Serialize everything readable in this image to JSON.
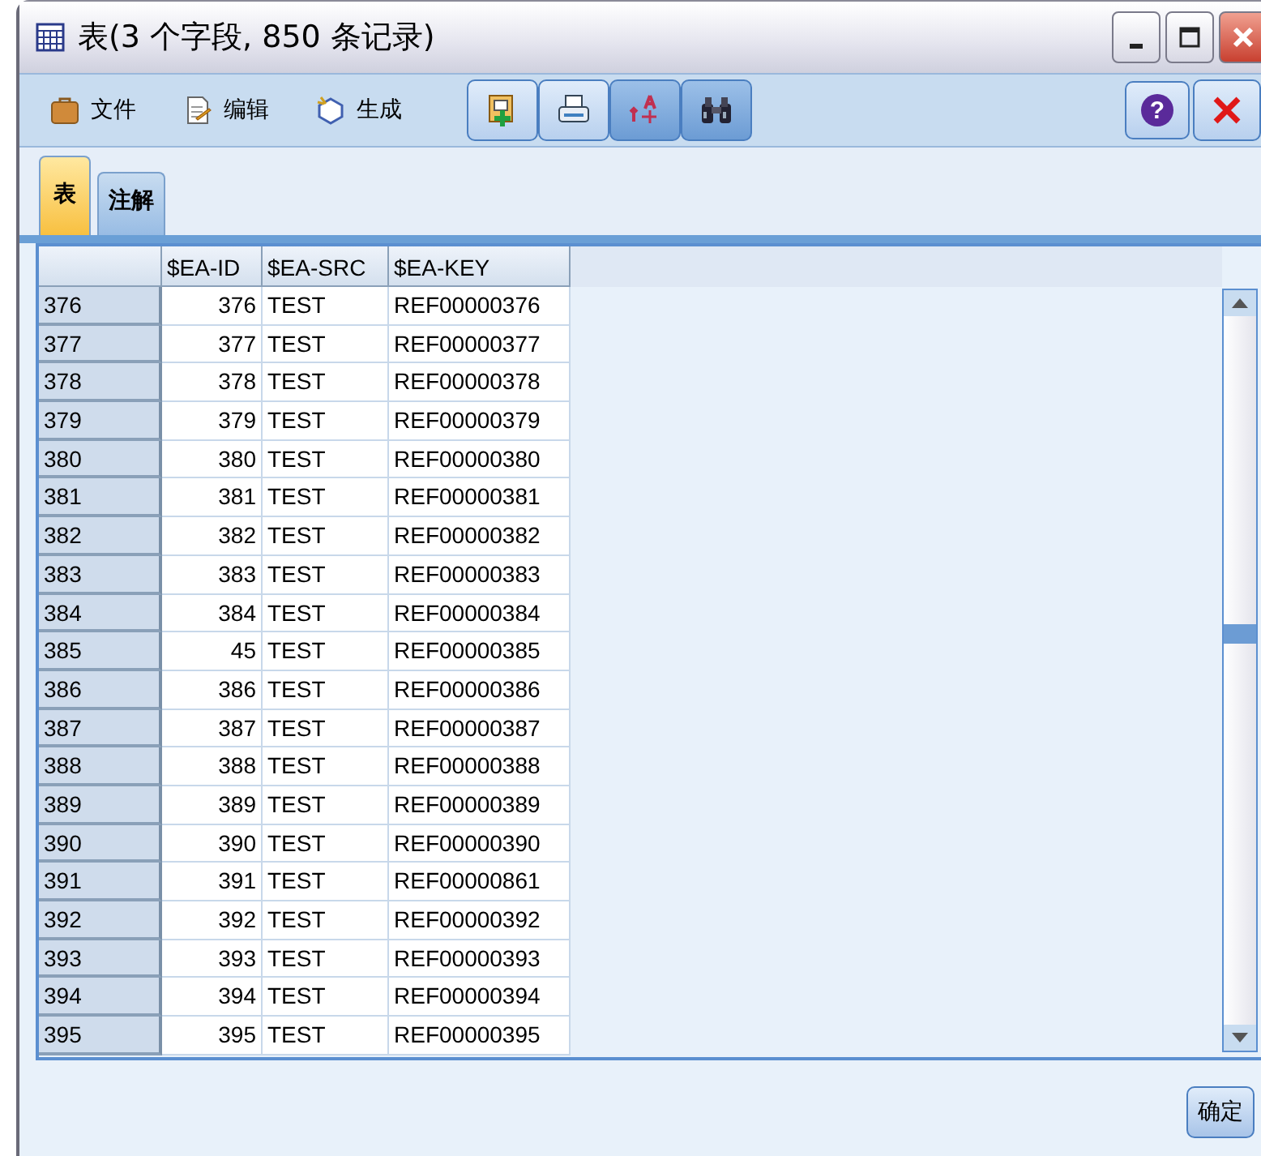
{
  "window": {
    "title": "表(3 个字段, 850 条记录)"
  },
  "toolbar": {
    "menus": [
      {
        "label": "文件",
        "kind": "file"
      },
      {
        "label": "编辑",
        "kind": "edit"
      },
      {
        "label": "生成",
        "kind": "generate"
      }
    ],
    "help": "?"
  },
  "tabs": [
    {
      "label": "表",
      "selected": true
    },
    {
      "label": "注解",
      "selected": false
    }
  ],
  "table": {
    "columns": [
      "$EA-ID",
      "$EA-SRC",
      "$EA-KEY"
    ],
    "rows": [
      {
        "row": "376",
        "id": "376",
        "src": "TEST",
        "key": "REF00000376"
      },
      {
        "row": "377",
        "id": "377",
        "src": "TEST",
        "key": "REF00000377"
      },
      {
        "row": "378",
        "id": "378",
        "src": "TEST",
        "key": "REF00000378"
      },
      {
        "row": "379",
        "id": "379",
        "src": "TEST",
        "key": "REF00000379"
      },
      {
        "row": "380",
        "id": "380",
        "src": "TEST",
        "key": "REF00000380"
      },
      {
        "row": "381",
        "id": "381",
        "src": "TEST",
        "key": "REF00000381"
      },
      {
        "row": "382",
        "id": "382",
        "src": "TEST",
        "key": "REF00000382"
      },
      {
        "row": "383",
        "id": "383",
        "src": "TEST",
        "key": "REF00000383"
      },
      {
        "row": "384",
        "id": "384",
        "src": "TEST",
        "key": "REF00000384"
      },
      {
        "row": "385",
        "id": "45",
        "src": "TEST",
        "key": "REF00000385"
      },
      {
        "row": "386",
        "id": "386",
        "src": "TEST",
        "key": "REF00000386"
      },
      {
        "row": "387",
        "id": "387",
        "src": "TEST",
        "key": "REF00000387"
      },
      {
        "row": "388",
        "id": "388",
        "src": "TEST",
        "key": "REF00000388"
      },
      {
        "row": "389",
        "id": "389",
        "src": "TEST",
        "key": "REF00000389"
      },
      {
        "row": "390",
        "id": "390",
        "src": "TEST",
        "key": "REF00000390"
      },
      {
        "row": "391",
        "id": "391",
        "src": "TEST",
        "key": "REF00000861"
      },
      {
        "row": "392",
        "id": "392",
        "src": "TEST",
        "key": "REF00000392"
      },
      {
        "row": "393",
        "id": "393",
        "src": "TEST",
        "key": "REF00000393"
      },
      {
        "row": "394",
        "id": "394",
        "src": "TEST",
        "key": "REF00000394"
      },
      {
        "row": "395",
        "id": "395",
        "src": "TEST",
        "key": "REF00000395"
      }
    ]
  },
  "buttons": [
    {
      "label": "确定"
    }
  ]
}
